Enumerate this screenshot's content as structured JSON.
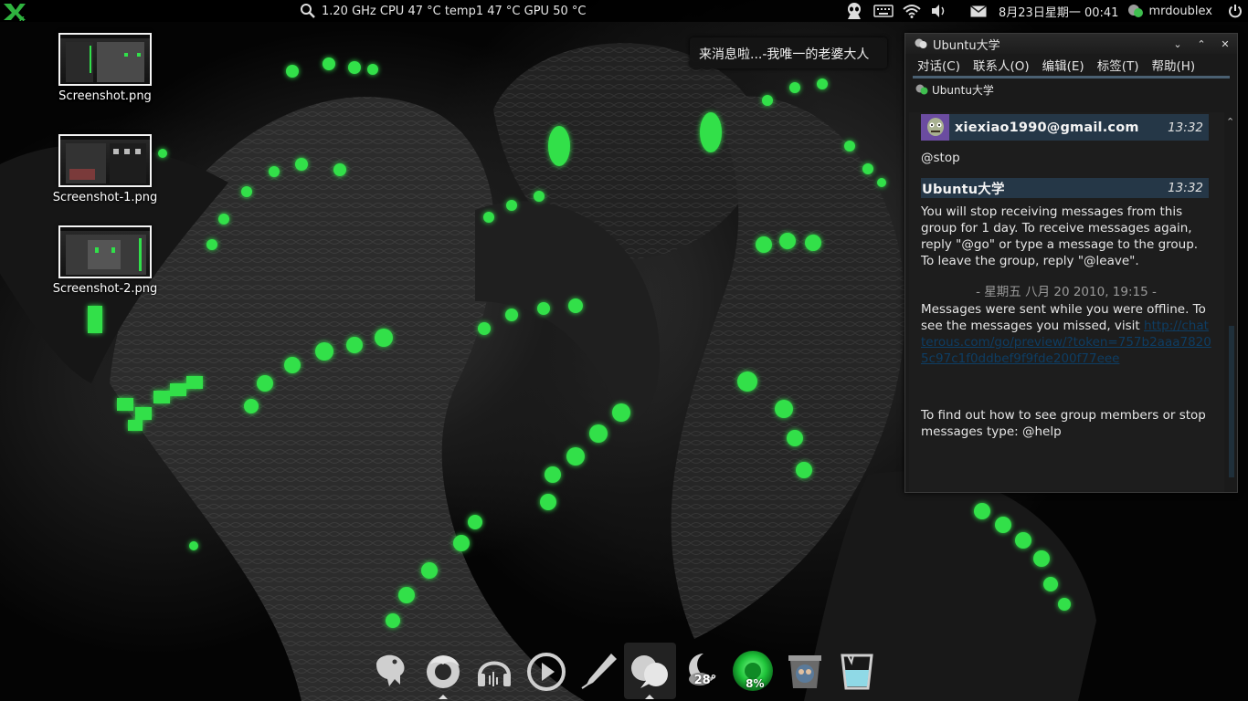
{
  "top_panel": {
    "sysmon_text": "1.20 GHz CPU 47 °C temp1 47 °C GPU 50 °C",
    "clock": "8月23日星期一 00:41",
    "username": "mrdoublex"
  },
  "desktop_icons": [
    {
      "label": "Screenshot.png"
    },
    {
      "label": "Screenshot-1.png"
    },
    {
      "label": "Screenshot-2.png"
    }
  ],
  "notification": {
    "text": "来消息啦...-我唯一的老婆大人"
  },
  "chat_window": {
    "title": "Ubuntu大学",
    "menu": [
      "对话(C)",
      "联系人(O)",
      "编辑(E)",
      "标签(T)",
      "帮助(H)"
    ],
    "tab_label": "Ubuntu大学",
    "messages": [
      {
        "sender": "xiexiao1990@gmail.com",
        "time": "13:32",
        "text": "@stop"
      },
      {
        "sender": "Ubuntu大学",
        "time": "13:32",
        "text": "You will stop receiving messages from this group for 1 day. To receive messages again, reply \"@go\" or type a message to the group. To leave the group, reply \"@leave\"."
      }
    ],
    "date_separator": "- 星期五 八月 20 2010, 19:15 -",
    "offline_text": "Messages were sent while you were offline. To see the messages you missed, visit",
    "offline_link": "http://chatterous.com/go/preview/?token=757b2aaa78205c97c1f0ddbef9f9fde200f77eee",
    "help_text": "To find out how to see group members or stop messages type: @help"
  },
  "dock": {
    "weather_temp": "28°",
    "battery_percent": "8%",
    "items": [
      "pidgin-icon",
      "firefox-icon",
      "audio-player-icon",
      "media-player-icon",
      "editor-icon",
      "empathy-icon",
      "weather-icon",
      "battery-icon",
      "trash-icon",
      "cup-icon"
    ]
  },
  "colors": {
    "accent_green": "#31e04a",
    "chat_header_bg": "#253747",
    "link_color": "#0e3d63"
  }
}
